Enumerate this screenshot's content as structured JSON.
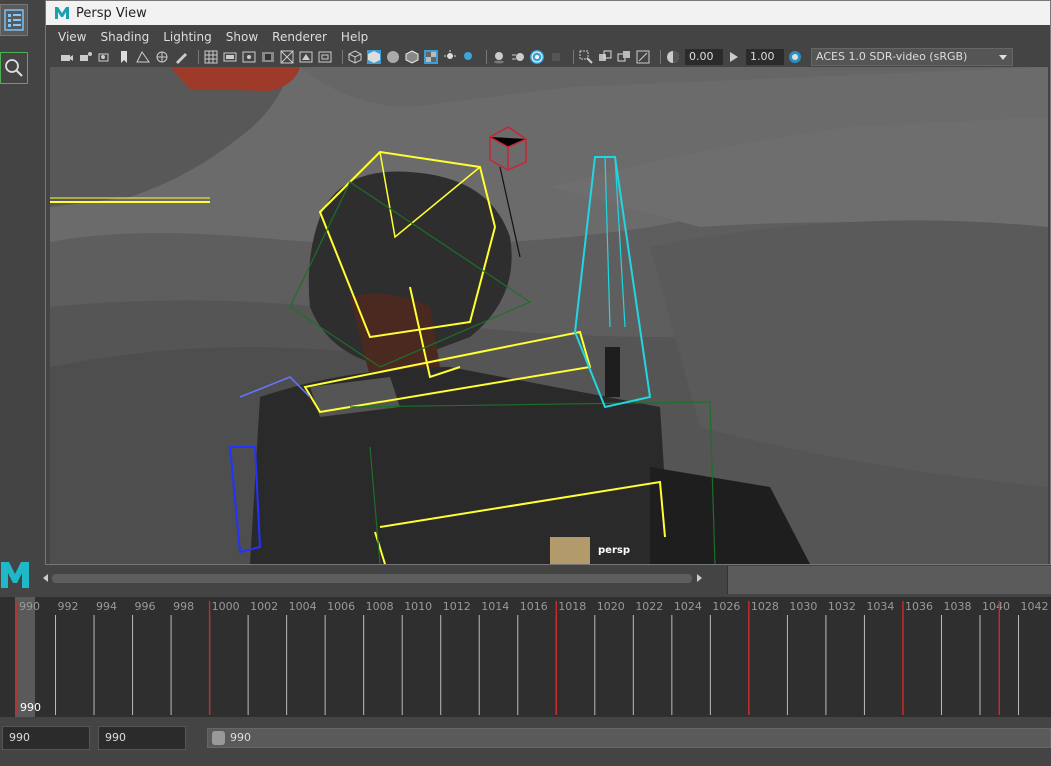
{
  "window": {
    "title": "Persp View"
  },
  "menu": [
    "View",
    "Shading",
    "Lighting",
    "Show",
    "Renderer",
    "Help"
  ],
  "toolbar": {
    "exposure": "0.00",
    "gamma": "1.00",
    "color_space": "ACES 1.0 SDR-video (sRGB)"
  },
  "viewport": {
    "camera_label": "persp"
  },
  "timeline": {
    "ticks": [
      "990",
      "992",
      "994",
      "996",
      "998",
      "1000",
      "1002",
      "1004",
      "1006",
      "1008",
      "1010",
      "1012",
      "1014",
      "1016",
      "1018",
      "1020",
      "1022",
      "1024",
      "1026",
      "1028",
      "1030",
      "1032",
      "1034",
      "1036",
      "1038",
      "1040",
      "1042"
    ],
    "current_frame": "990",
    "keyframes": [
      990,
      1000,
      1018,
      1028,
      1036,
      1041
    ]
  },
  "range": {
    "start": "990",
    "end": "990",
    "slider_value": "990"
  },
  "colors": {
    "selection": "#ffff33",
    "camera": "#22d6e0",
    "key": "#cc2a2a",
    "light": "#cc2233"
  }
}
